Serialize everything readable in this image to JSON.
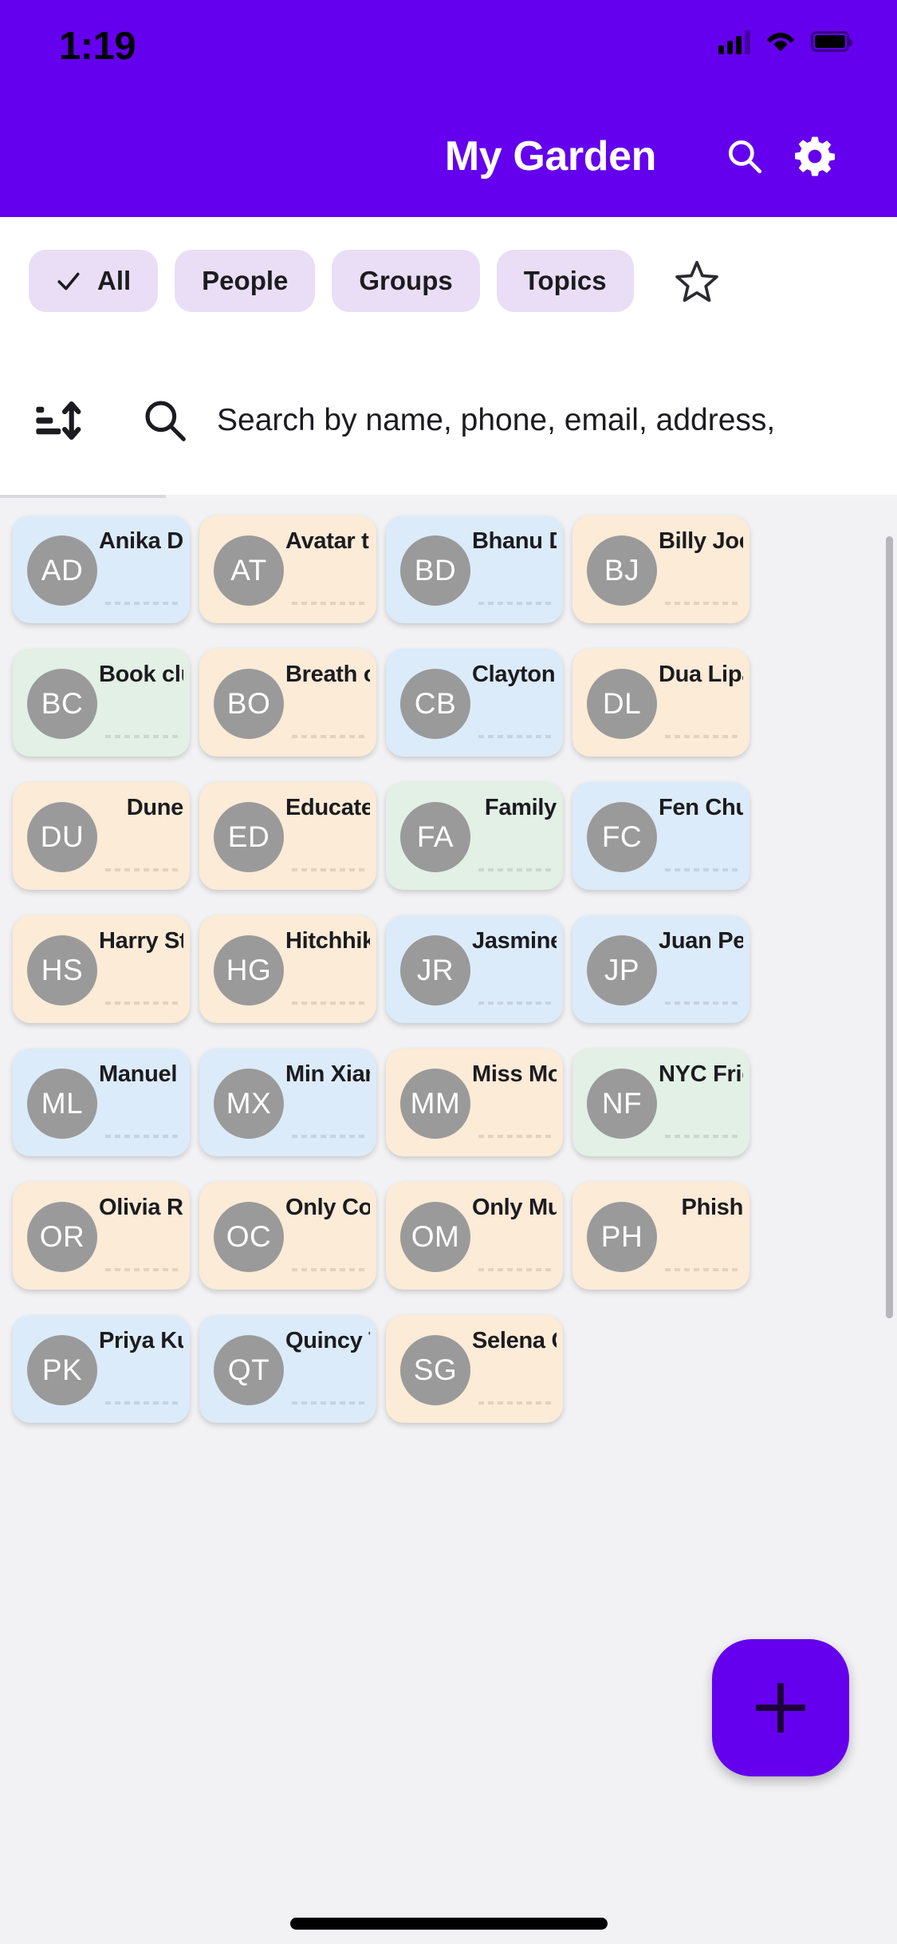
{
  "status_bar": {
    "time": "1:19",
    "cellular_icon": "cellular-signal-icon",
    "wifi_icon": "wifi-icon",
    "battery_icon": "battery-icon"
  },
  "app_bar": {
    "title": "My Garden",
    "search_icon": "search-icon",
    "settings_icon": "gear-icon",
    "background_color": "#6400ED",
    "title_color": "#FFFFFF"
  },
  "filters": {
    "chips": [
      {
        "label": "All",
        "selected": true,
        "check_icon": "check-icon"
      },
      {
        "label": "People",
        "selected": false
      },
      {
        "label": "Groups",
        "selected": false
      },
      {
        "label": "Topics",
        "selected": false
      }
    ],
    "favorite_icon": "star-outline-icon",
    "chip_background": "#E9DEF6",
    "chip_text_color": "#1C1B1F"
  },
  "search": {
    "sort_icon": "sort-icon",
    "search_icon": "search-icon",
    "placeholder": "Search by name, phone, email, address,",
    "value": ""
  },
  "fab": {
    "icon": "plus-icon",
    "label": "Add",
    "color": "#6400ED"
  },
  "grid": {
    "scrollbar": "vertical-scrollbar",
    "colors": {
      "person": "#DCEBF9",
      "topic": "#FBEBD7",
      "group": "#E2F0E5",
      "avatar": "#9A9A9A",
      "page_background": "#F2F2F4"
    },
    "cards": [
      {
        "initials": "AD",
        "name": "Anika Devi",
        "kind": "blue"
      },
      {
        "initials": "AT",
        "name": "Avatar th…",
        "kind": "peach"
      },
      {
        "initials": "BD",
        "name": "Bhanu D…",
        "kind": "blue"
      },
      {
        "initials": "BJ",
        "name": "Billy Joel",
        "kind": "peach"
      },
      {
        "initials": "BC",
        "name": "Book club",
        "kind": "green"
      },
      {
        "initials": "BO",
        "name": "Breath of…",
        "kind": "peach"
      },
      {
        "initials": "CB",
        "name": "Clayton…",
        "kind": "blue"
      },
      {
        "initials": "DL",
        "name": "Dua Lipa",
        "kind": "peach"
      },
      {
        "initials": "DU",
        "name": "Dune",
        "kind": "peach"
      },
      {
        "initials": "ED",
        "name": "Educated",
        "kind": "peach"
      },
      {
        "initials": "FA",
        "name": "Family",
        "kind": "green"
      },
      {
        "initials": "FC",
        "name": "Fen Chu…",
        "kind": "blue"
      },
      {
        "initials": "HS",
        "name": "Harry St…",
        "kind": "peach"
      },
      {
        "initials": "HG",
        "name": "Hitchhik…",
        "kind": "peach"
      },
      {
        "initials": "JR",
        "name": "Jasmine…",
        "kind": "blue"
      },
      {
        "initials": "JP",
        "name": "Juan Perez",
        "kind": "blue"
      },
      {
        "initials": "ML",
        "name": "Manuel L…",
        "kind": "blue"
      },
      {
        "initials": "MX",
        "name": "Min Xian…",
        "kind": "blue"
      },
      {
        "initials": "MM",
        "name": "Miss Mo…",
        "kind": "peach"
      },
      {
        "initials": "NF",
        "name": "NYC Frie…",
        "kind": "green"
      },
      {
        "initials": "OR",
        "name": "Olivia Ro…",
        "kind": "peach"
      },
      {
        "initials": "OC",
        "name": "Only Co…",
        "kind": "peach"
      },
      {
        "initials": "OM",
        "name": "Only Mur…",
        "kind": "peach"
      },
      {
        "initials": "PH",
        "name": "Phish",
        "kind": "peach"
      },
      {
        "initials": "PK",
        "name": "Priya Ku…",
        "kind": "blue"
      },
      {
        "initials": "QT",
        "name": "Quincy T",
        "kind": "blue"
      },
      {
        "initials": "SG",
        "name": "Selena G…",
        "kind": "peach"
      }
    ]
  },
  "home_indicator": "home-indicator"
}
